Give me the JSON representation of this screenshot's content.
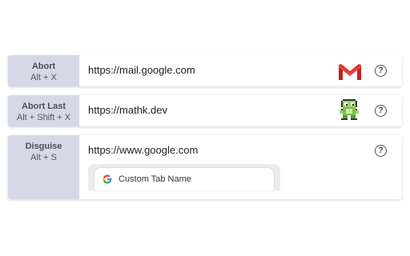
{
  "rows": [
    {
      "name": "Abort",
      "combo": "Alt + X",
      "url": "https://mail.google.com",
      "icon": "gmail-icon",
      "help": "?"
    },
    {
      "name": "Abort Last",
      "combo": "Alt + Shift + X",
      "url": "https://mathk.dev",
      "icon": "pixel-frog-icon",
      "help": "?"
    },
    {
      "name": "Disguise",
      "combo": "Alt + S",
      "url": "https://www.google.com",
      "help": "?",
      "tab": {
        "icon": "google-g-icon",
        "title": "Custom Tab Name"
      }
    }
  ],
  "colors": {
    "key_bg": "#d6d9e5",
    "gmail_red": "#d93025"
  }
}
